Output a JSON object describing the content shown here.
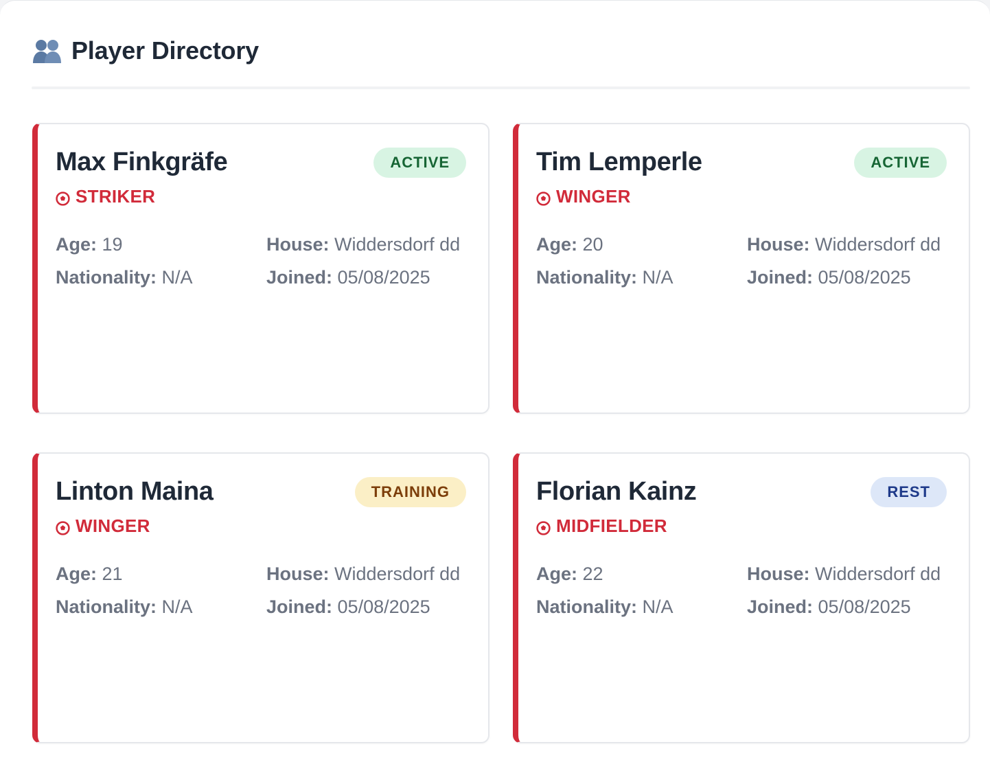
{
  "header": {
    "title": "Player Directory",
    "icon": "people-icon"
  },
  "labels": {
    "age": "Age:",
    "house": "House:",
    "nationality": "Nationality:",
    "joined": "Joined:"
  },
  "colors": {
    "accent": "#d12b3a",
    "active_bg": "#d8f4e3",
    "active_text": "#166534",
    "training_bg": "#fbefc6",
    "training_text": "#7c3e0a",
    "rest_bg": "#dde7f8",
    "rest_text": "#1e3a8a"
  },
  "players": [
    {
      "name": "Max Finkgräfe",
      "position": "STRIKER",
      "status": "ACTIVE",
      "status_type": "active",
      "age": "19",
      "house": "Widdersdorf dd",
      "nationality": "N/A",
      "joined": "05/08/2025"
    },
    {
      "name": "Tim Lemperle",
      "position": "WINGER",
      "status": "ACTIVE",
      "status_type": "active",
      "age": "20",
      "house": "Widdersdorf dd",
      "nationality": "N/A",
      "joined": "05/08/2025"
    },
    {
      "name": "Linton Maina",
      "position": "WINGER",
      "status": "TRAINING",
      "status_type": "training",
      "age": "21",
      "house": "Widdersdorf dd",
      "nationality": "N/A",
      "joined": "05/08/2025"
    },
    {
      "name": "Florian Kainz",
      "position": "MIDFIELDER",
      "status": "REST",
      "status_type": "rest",
      "age": "22",
      "house": "Widdersdorf dd",
      "nationality": "N/A",
      "joined": "05/08/2025"
    }
  ]
}
